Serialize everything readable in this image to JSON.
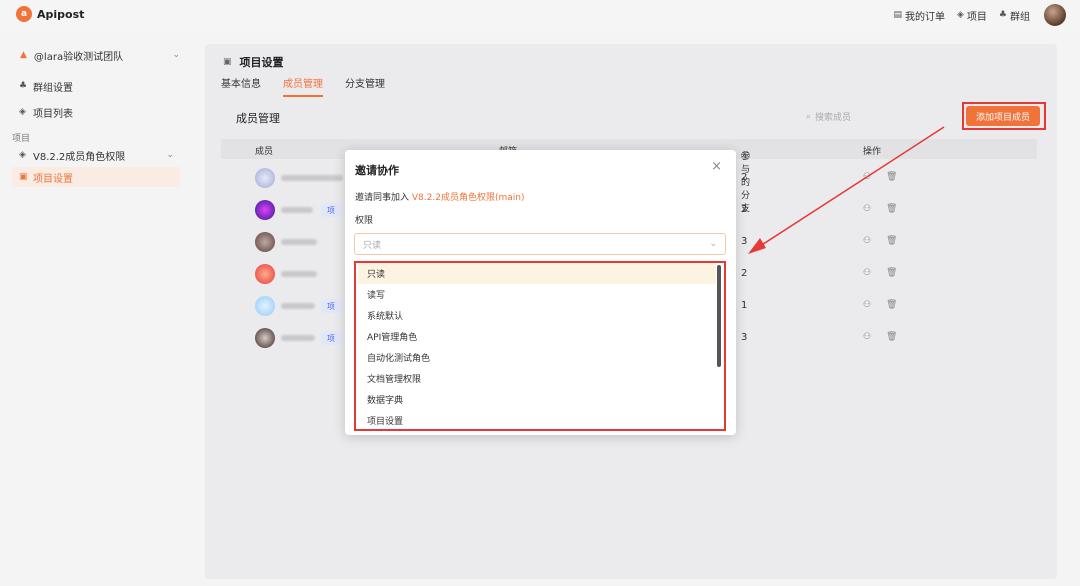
{
  "header": {
    "brand": "Apipost",
    "logo_glyph": "a",
    "links": [
      {
        "icon": "clipboard-icon",
        "glyph": "▤",
        "label": "我的订单"
      },
      {
        "icon": "layers-icon",
        "glyph": "◈",
        "label": "项目"
      },
      {
        "icon": "group-icon",
        "glyph": "♣",
        "label": "群组"
      }
    ]
  },
  "sidebar": {
    "team_name": "@lara验收测试团队",
    "items": [
      {
        "icon": "group-icon",
        "glyph": "♣",
        "label": "群组设置"
      },
      {
        "icon": "layers-icon",
        "glyph": "◈",
        "label": "项目列表"
      }
    ],
    "section_label": "项目",
    "project": {
      "icon": "layers-icon",
      "glyph": "◈",
      "label": "V8.2.2成员角色权限"
    },
    "active_item": {
      "icon": "settings-square-icon",
      "glyph": "▣",
      "label": "项目设置"
    }
  },
  "main": {
    "title": "项目设置",
    "tabs": [
      {
        "label": "基本信息",
        "active": false
      },
      {
        "label": "成员管理",
        "active": true
      },
      {
        "label": "分支管理",
        "active": false
      }
    ],
    "section_title": "成员管理",
    "search_placeholder": "搜索成员",
    "add_button_label": "添加项目成员",
    "columns": {
      "member": "成员",
      "email": "邮箱",
      "branches": "参与的分支",
      "actions": "操作"
    },
    "rows": [
      {
        "branches": "2",
        "tag": ""
      },
      {
        "branches": "2",
        "tag": "项"
      },
      {
        "branches": "3",
        "tag": ""
      },
      {
        "branches": "2",
        "tag": ""
      },
      {
        "branches": "1",
        "tag": "项"
      },
      {
        "branches": "3",
        "tag": "项"
      }
    ]
  },
  "modal": {
    "title": "邀请协作",
    "close_glyph": "×",
    "invite_prefix": "邀请同事加入",
    "invite_project": "V8.2.2成员角色权限(main)",
    "permission_label": "权限",
    "select_placeholder": "只读",
    "options": [
      "只读",
      "读写",
      "系统默认",
      "API管理角色",
      "自动化测试角色",
      "文档管理权限",
      "数据字典",
      "项目设置"
    ],
    "selected_option": "只读"
  },
  "colors": {
    "accent": "#f1733a",
    "highlight": "#e53935",
    "tag_text": "#4a6cf7"
  }
}
